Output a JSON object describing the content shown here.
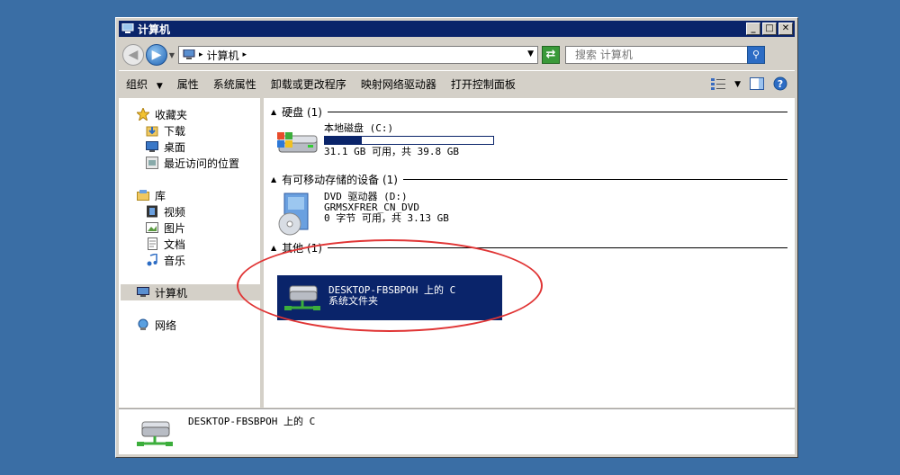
{
  "window": {
    "title": "计算机"
  },
  "address": {
    "path": "计算机"
  },
  "search": {
    "placeholder": "搜索 计算机"
  },
  "toolbar": {
    "organize": "组织",
    "properties": "属性",
    "system_properties": "系统属性",
    "uninstall": "卸载或更改程序",
    "map_drive": "映射网络驱动器",
    "control_panel": "打开控制面板"
  },
  "nav": {
    "favorites": "收藏夹",
    "downloads": "下载",
    "desktop": "桌面",
    "recent": "最近访问的位置",
    "libraries": "库",
    "videos": "视频",
    "pictures": "图片",
    "documents": "文档",
    "music": "音乐",
    "computer": "计算机",
    "network": "网络"
  },
  "groups": {
    "hdd": "硬盘 (1)",
    "removable": "有可移动存储的设备 (1)",
    "other": "其他 (1)"
  },
  "drives": {
    "local": {
      "name": "本地磁盘 (C:)",
      "space": "31.1 GB 可用，共 39.8 GB",
      "used_fraction": 0.22
    },
    "dvd": {
      "name": "DVD 驱动器 (D:)",
      "label": "GRMSXFRER_CN_DVD",
      "space": "0 字节 可用，共 3.13 GB"
    },
    "network": {
      "name": "DESKTOP-FBSBPOH 上的 C",
      "type": "系统文件夹"
    }
  },
  "details": {
    "name": "DESKTOP-FBSBPOH 上的 C"
  },
  "colors": {
    "desktop": "#3a6ea5",
    "selection": "#0a246a",
    "annotation": "#e03535"
  }
}
